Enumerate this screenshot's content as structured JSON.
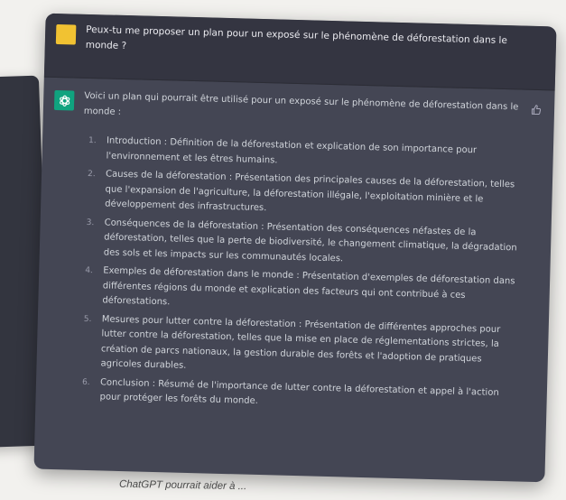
{
  "user_message": {
    "text": "Peux-tu me proposer un plan pour un exposé sur le phénomène de déforestation dans le monde ?"
  },
  "assistant_message": {
    "intro": "Voici un plan qui pourrait être utilisé pour un exposé sur le phénomène de déforestation dans le monde :",
    "items": [
      {
        "num": "1.",
        "text": "Introduction : Définition de la déforestation et explication de son importance pour l'environnement et les êtres humains."
      },
      {
        "num": "2.",
        "text": "Causes de la déforestation : Présentation des principales causes de la déforestation, telles que l'expansion de l'agriculture, la déforestation illégale, l'exploitation minière et le développement des infrastructures."
      },
      {
        "num": "3.",
        "text": "Conséquences de la déforestation : Présentation des conséquences néfastes de la déforestation, telles que la perte de biodiversité, le changement climatique, la dégradation des sols et les impacts sur les communautés locales."
      },
      {
        "num": "4.",
        "text": "Exemples de déforestation dans le monde : Présentation d'exemples de déforestation dans différentes régions du monde et explication des facteurs qui ont contribué à ces déforestations."
      },
      {
        "num": "5.",
        "text": "Mesures pour lutter contre la déforestation : Présentation de différentes approches pour lutter contre la déforestation, telles que la mise en place de réglementations strictes, la création de parcs nationaux, la gestion durable des forêts et l'adoption de pratiques agricoles durables."
      },
      {
        "num": "6.",
        "text": "Conclusion : Résumé de l'importance de lutter contre la déforestation et appel à l'action pour protéger les forêts du monde."
      }
    ]
  },
  "caption": "ChatGPT pourrait aider à ...",
  "icons": {
    "user_avatar": "user-avatar-icon",
    "bot_avatar": "openai-logo-icon",
    "feedback": "thumbs-up-icon"
  },
  "colors": {
    "user_row_bg": "#343541",
    "assistant_row_bg": "#444654",
    "user_avatar": "#f1c232",
    "bot_avatar": "#10a37f"
  }
}
